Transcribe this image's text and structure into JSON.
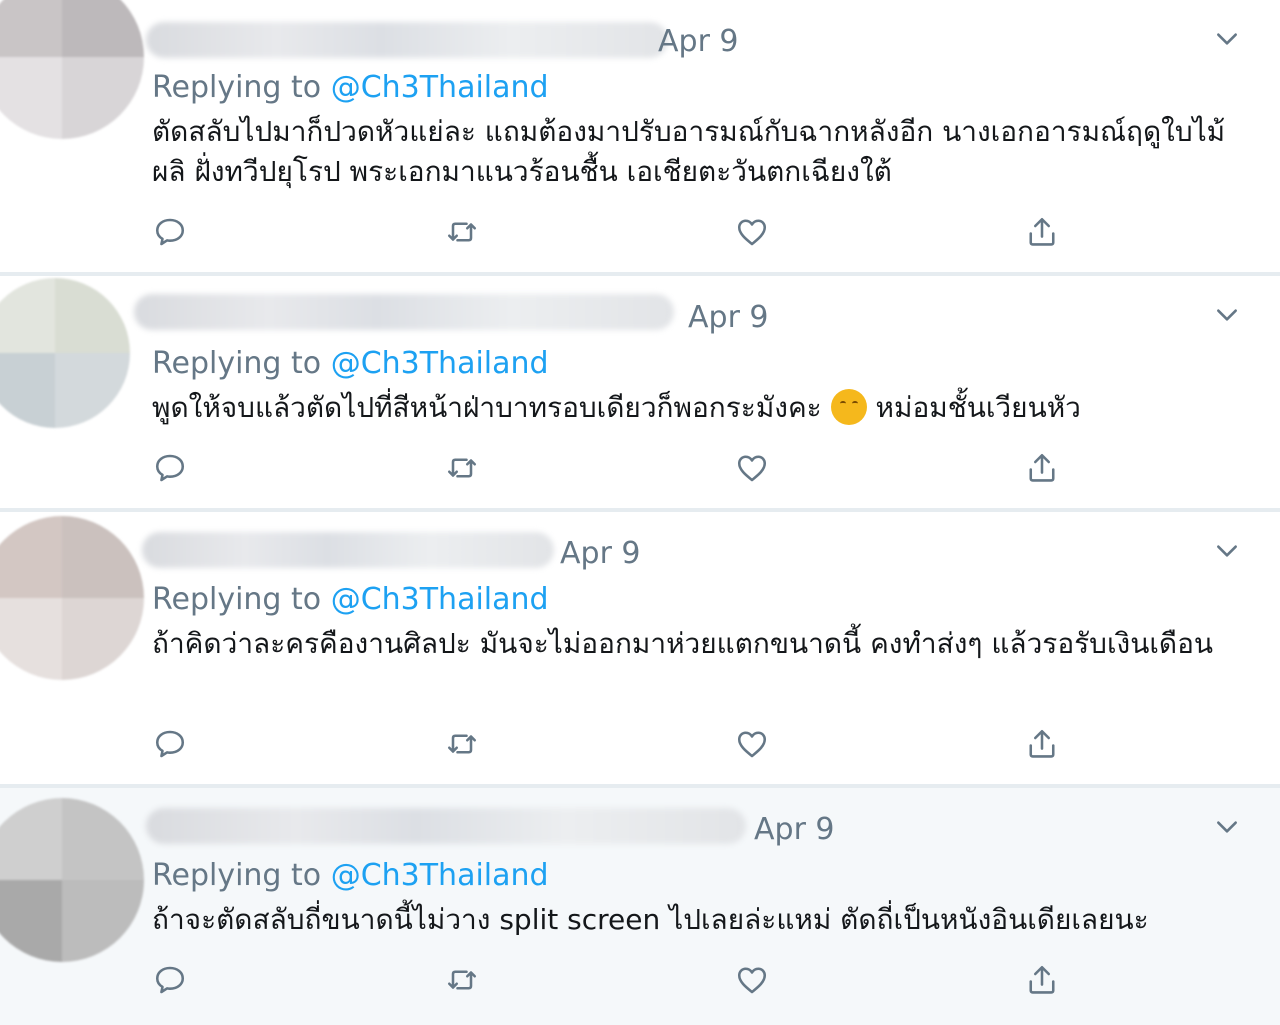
{
  "tweets": [
    {
      "date": "Apr 9",
      "replying_prefix": "Replying to",
      "handle": "@Ch3Thailand",
      "text": "ตัดสลับไปมาก็ปวดหัวแย่ละ แถมต้องมาปรับอารมณ์กับฉากหลังอีก นางเอกอารมณ์ฤดูใบไม้ผลิ ฝั่งทวีปยุโรป พระเอกมาแนวร้อนชื้น เอเชียตะวันตกเฉียงใต้",
      "avatar_colors": [
        "#c9c5c6",
        "#bdb9bb",
        "#e4e1e3",
        "#d8d5d7"
      ]
    },
    {
      "date": "Apr 9",
      "replying_prefix": "Replying to",
      "handle": "@Ch3Thailand",
      "text_before_emoji": "พูดให้จบแล้วตัดไปที่สีหน้าฝ่าบาทรอบเดียวก็พอกระมังคะ",
      "emoji_name": "kissing-face-emoji",
      "text_after_emoji": "หม่อมชั้นเวียนหัว",
      "avatar_colors": [
        "#e2e5de",
        "#d9ddd3",
        "#c8d0d4",
        "#d3d9dc"
      ]
    },
    {
      "date": "Apr 9",
      "replying_prefix": "Replying to",
      "handle": "@Ch3Thailand",
      "text": "ถ้าคิดว่าละครคืองานศิลปะ มันจะไม่ออกมาห่วยแตกขนาดนี้ คงทำส่งๆ แล้วรอรับเงินเดือน",
      "avatar_colors": [
        "#d3c7c3",
        "#cbc1be",
        "#e6e0de",
        "#ddd6d4"
      ]
    },
    {
      "date": "Apr 9",
      "replying_prefix": "Replying to",
      "handle": "@Ch3Thailand",
      "text": "ถ้าจะตัดสลับถี่ขนาดนี้ไม่วาง split screen ไปเลยล่ะแหม่ ตัดถี่เป็นหนังอินเดียเลยนะ",
      "avatar_colors": [
        "#cfcfcf",
        "#c4c4c4",
        "#a9a9a9",
        "#bcbcbc"
      ]
    }
  ],
  "icons": {
    "reply": "reply-icon",
    "retweet": "retweet-icon",
    "like": "heart-icon",
    "share": "share-icon",
    "menu": "chevron-down-icon"
  },
  "colors": {
    "accent": "#1da1f2",
    "muted": "#657786",
    "text": "#14171a",
    "divider": "#e6ecf0"
  }
}
